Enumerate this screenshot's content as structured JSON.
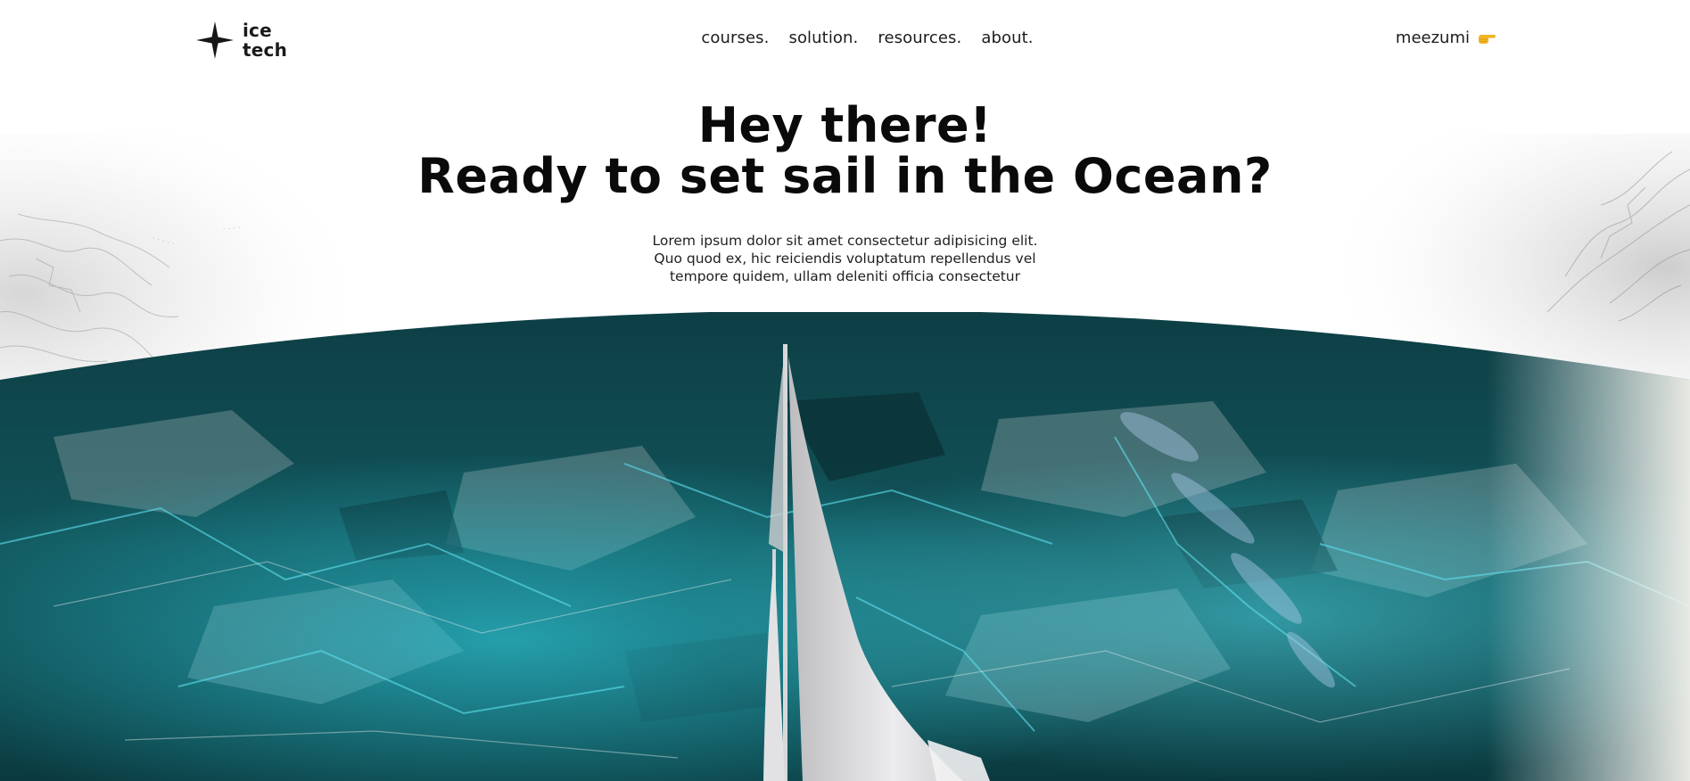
{
  "brand": {
    "line1": "ice",
    "line2": "tech",
    "logo_icon": "compass-star-icon"
  },
  "nav": {
    "items": [
      {
        "label": "courses."
      },
      {
        "label": "solution."
      },
      {
        "label": "resources."
      },
      {
        "label": "about."
      }
    ]
  },
  "user": {
    "name": "meezumi",
    "icon": "pointing-hand-icon"
  },
  "hero": {
    "title_line1": "Hey there!",
    "title_line2": "Ready to set sail in the Ocean?",
    "subtitle_line1": "Lorem ipsum dolor sit amet consectetur adipisicing elit.",
    "subtitle_line2": "Quo quod ex, hic reiciendis voluptatum repellendus vel",
    "subtitle_line3": "tempore quidem, ullam deleniti officia consectetur"
  },
  "colors": {
    "text": "#0a0a0a",
    "ocean_dark": "#0b3b40",
    "ocean_teal": "#1fa9b8",
    "ocean_cyan": "#3fd4e6",
    "sail": "#e4e4e6",
    "accent_hand": "#f2b523"
  }
}
